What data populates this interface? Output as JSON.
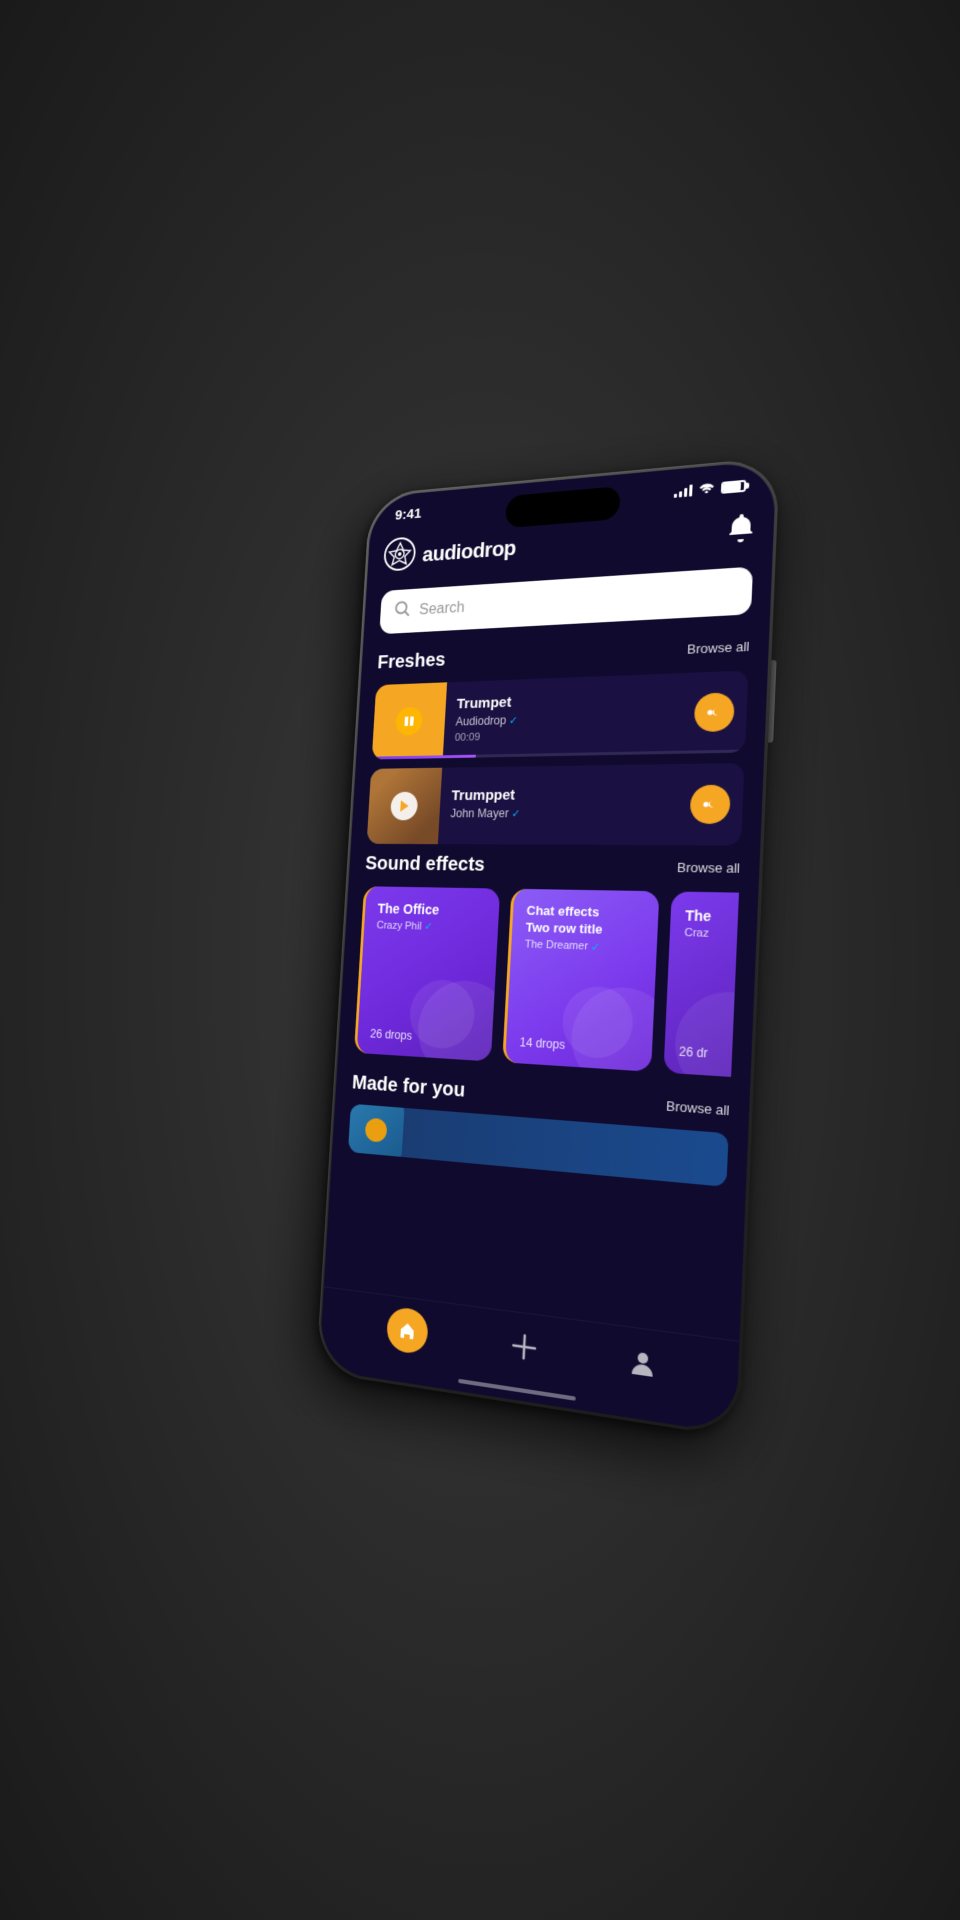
{
  "app": {
    "name": "audiodrop",
    "time": "9:41"
  },
  "header": {
    "notification_icon": "bell"
  },
  "search": {
    "placeholder": "Search"
  },
  "sections": {
    "freshes": {
      "title": "Freshes",
      "browse_all": "Browse all",
      "tracks": [
        {
          "title": "Trumpet",
          "artist": "Audiodrop",
          "verified": true,
          "duration": "00:09",
          "state": "playing",
          "progress": 30
        },
        {
          "title": "Trumppet",
          "artist": "John Mayer",
          "verified": true,
          "duration": "",
          "state": "paused",
          "progress": 0
        }
      ]
    },
    "sound_effects": {
      "title": "Sound effects",
      "browse_all": "Browse all",
      "cards": [
        {
          "title": "The Office",
          "artist": "Crazy Phil",
          "verified": true,
          "drops": "26 drops"
        },
        {
          "title": "Chat effects Two row title",
          "artist": "The Dreamer",
          "verified": true,
          "drops": "14 drops"
        },
        {
          "title": "The",
          "artist": "Craz",
          "verified": false,
          "drops": "26 dr"
        }
      ]
    },
    "made_for_you": {
      "title": "Made for you",
      "browse_all": "Browse all"
    }
  },
  "nav": {
    "home": "home",
    "add": "+",
    "profile": "person"
  }
}
